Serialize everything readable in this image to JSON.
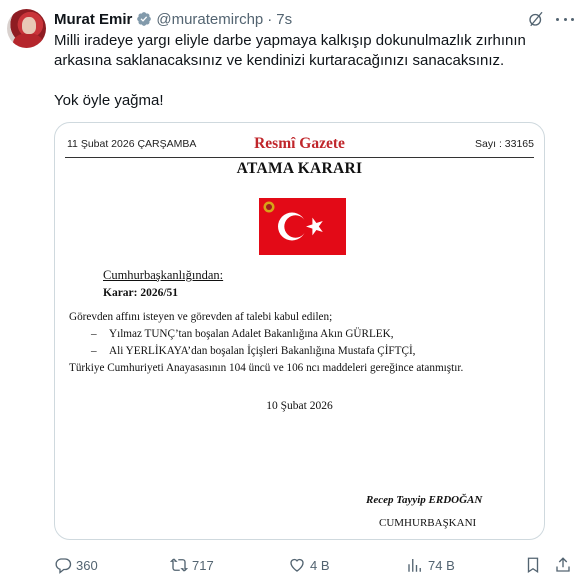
{
  "tweet": {
    "author_name": "Murat Emir",
    "handle": "@muratemirchp",
    "separator": "·",
    "time": "7s",
    "text_line1": "Milli iradeye yargı eliyle darbe yapmaya kalkışıp dokunulmazlık zırhının",
    "text_line2": "arkasına saklanacaksınız ve kendinizi kurtaracağınızı sanacaksınız.",
    "text_line3": "Yok öyle yağma!"
  },
  "gazette": {
    "date": "11 Şubat 2026 ÇARŞAMBA",
    "title": "Resmî Gazete",
    "issue": "Sayı : 33165",
    "decision_title": "ATAMA KARARI",
    "issuer": "Cumhurbaşkanlığından:",
    "decision_no": "Karar: 2026/51",
    "line1": "Görevden affını isteyen ve görevden af talebi kabul edilen;",
    "dash": "–",
    "line2": "Yılmaz TUNÇ’tan boşalan Adalet Bakanlığına Akın GÜRLEK,",
    "line3": "Ali YERLİKAYA’dan boşalan İçişleri Bakanlığına Mustafa ÇİFTÇİ,",
    "line4": "Türkiye Cumhuriyeti Anayasasının 104 üncü ve 106 ncı maddeleri gereğince atanmıştır.",
    "sign_date": "10 Şubat 2026",
    "signer": "Recep Tayyip ERDOĞAN",
    "signer_title": "CUMHURBAŞKANI"
  },
  "actions": {
    "replies": "360",
    "reposts": "717",
    "likes": "4 B",
    "views": "74 B"
  },
  "colors": {
    "verified_badge": "#829aab",
    "gazette_red": "#c0262b",
    "flag_red": "#e30a17",
    "muted_text": "#536471"
  },
  "icons": [
    "verified-icon",
    "grok-icon",
    "more-icon",
    "reply-icon",
    "repost-icon",
    "like-icon",
    "views-icon",
    "bookmark-icon",
    "share-icon",
    "turkish-flag"
  ]
}
